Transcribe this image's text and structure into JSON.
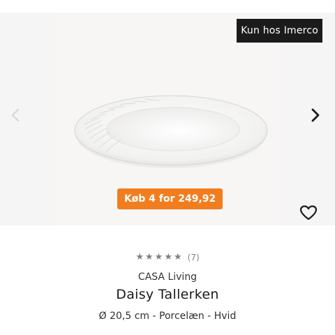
{
  "hero": {
    "exclusive_badge": "Kun hos Imerco",
    "promo_label": "Køb 4 for 249,92",
    "prev_icon": "chevron-left-icon",
    "next_icon": "chevron-right-icon",
    "favorite_icon": "heart-outline-icon"
  },
  "product": {
    "rating_stars": 5,
    "rating_count": "(7)",
    "brand": "CASA Living",
    "title": "Daisy Tallerken",
    "specs": "Ø 20,5 cm - Porcelæn - Hvid"
  },
  "colors": {
    "promo": "#f27d1f",
    "badge": "#1b1b1b",
    "stars": "#808080"
  }
}
